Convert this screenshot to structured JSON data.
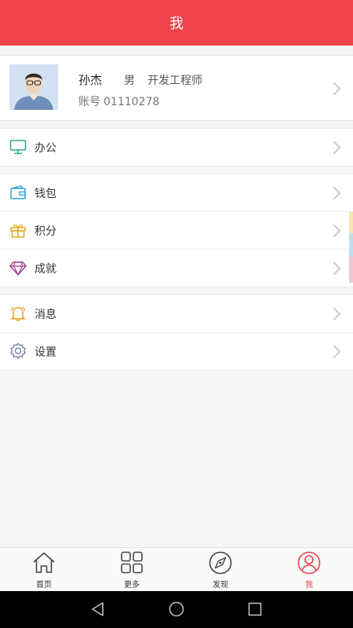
{
  "header": {
    "title": "我"
  },
  "profile": {
    "name": "孙杰",
    "gender": "男",
    "job_title": "开发工程师",
    "account_label": "账号",
    "account_number": "01110278"
  },
  "menu": {
    "office": {
      "label": "办公",
      "icon": "monitor-icon"
    },
    "wallet": {
      "label": "钱包",
      "icon": "wallet-icon"
    },
    "points": {
      "label": "积分",
      "icon": "gift-icon"
    },
    "achievement": {
      "label": "成就",
      "icon": "diamond-icon"
    },
    "messages": {
      "label": "消息",
      "icon": "bell-icon"
    },
    "settings": {
      "label": "设置",
      "icon": "gear-icon"
    }
  },
  "tabbar": {
    "home": {
      "label": "首页",
      "icon": "home-icon"
    },
    "more": {
      "label": "更多",
      "icon": "grid-icon"
    },
    "discover": {
      "label": "发现",
      "icon": "compass-icon"
    },
    "me": {
      "label": "我",
      "icon": "user-circle-icon"
    },
    "active": "me"
  },
  "colors": {
    "header": "#f0434b",
    "active_tab": "#e8424b",
    "office_icon": "#2aa38a",
    "wallet_icon": "#2a9fd6",
    "points_icon": "#e6a418",
    "achievement_icon": "#9b3a8f",
    "messages_icon": "#e89a1c",
    "settings_icon": "#6b7aa6"
  }
}
